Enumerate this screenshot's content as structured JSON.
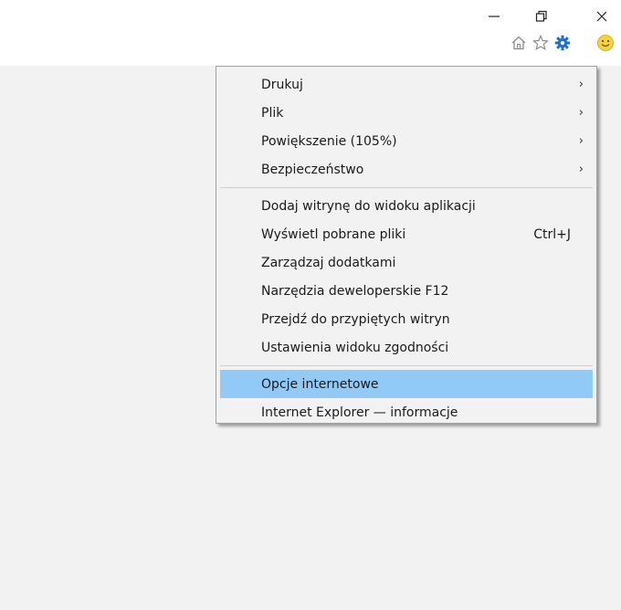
{
  "window_controls": {
    "minimize": "—",
    "restore": "❐",
    "close": "✕"
  },
  "toolbar": {
    "icons": [
      "home-icon",
      "favorites-star-icon",
      "tools-gear-icon",
      "smiley-feedback-icon"
    ]
  },
  "menu": {
    "group1": [
      {
        "label": "Drukuj",
        "arrow": "›"
      },
      {
        "label": "Plik",
        "arrow": "›"
      },
      {
        "label": "Powiększenie (105%)",
        "arrow": "›"
      },
      {
        "label": "Bezpieczeństwo",
        "arrow": "›"
      }
    ],
    "group2": [
      {
        "label": "Dodaj witrynę do widoku aplikacji"
      },
      {
        "label": "Wyświetl pobrane pliki",
        "shortcut": "Ctrl+J"
      },
      {
        "label": "Zarządzaj dodatkami"
      },
      {
        "label": "Narzędzia deweloperskie F12"
      },
      {
        "label": "Przejdź do przypiętych witryn"
      },
      {
        "label": "Ustawienia widoku zgodności"
      }
    ],
    "group3": [
      {
        "label": "Opcje internetowe",
        "highlighted": true
      },
      {
        "label": "Internet Explorer — informacje"
      }
    ]
  },
  "colors": {
    "highlight": "#91c9f7",
    "menu_bg": "#f2f2f2",
    "gear": "#1e6fc8"
  }
}
